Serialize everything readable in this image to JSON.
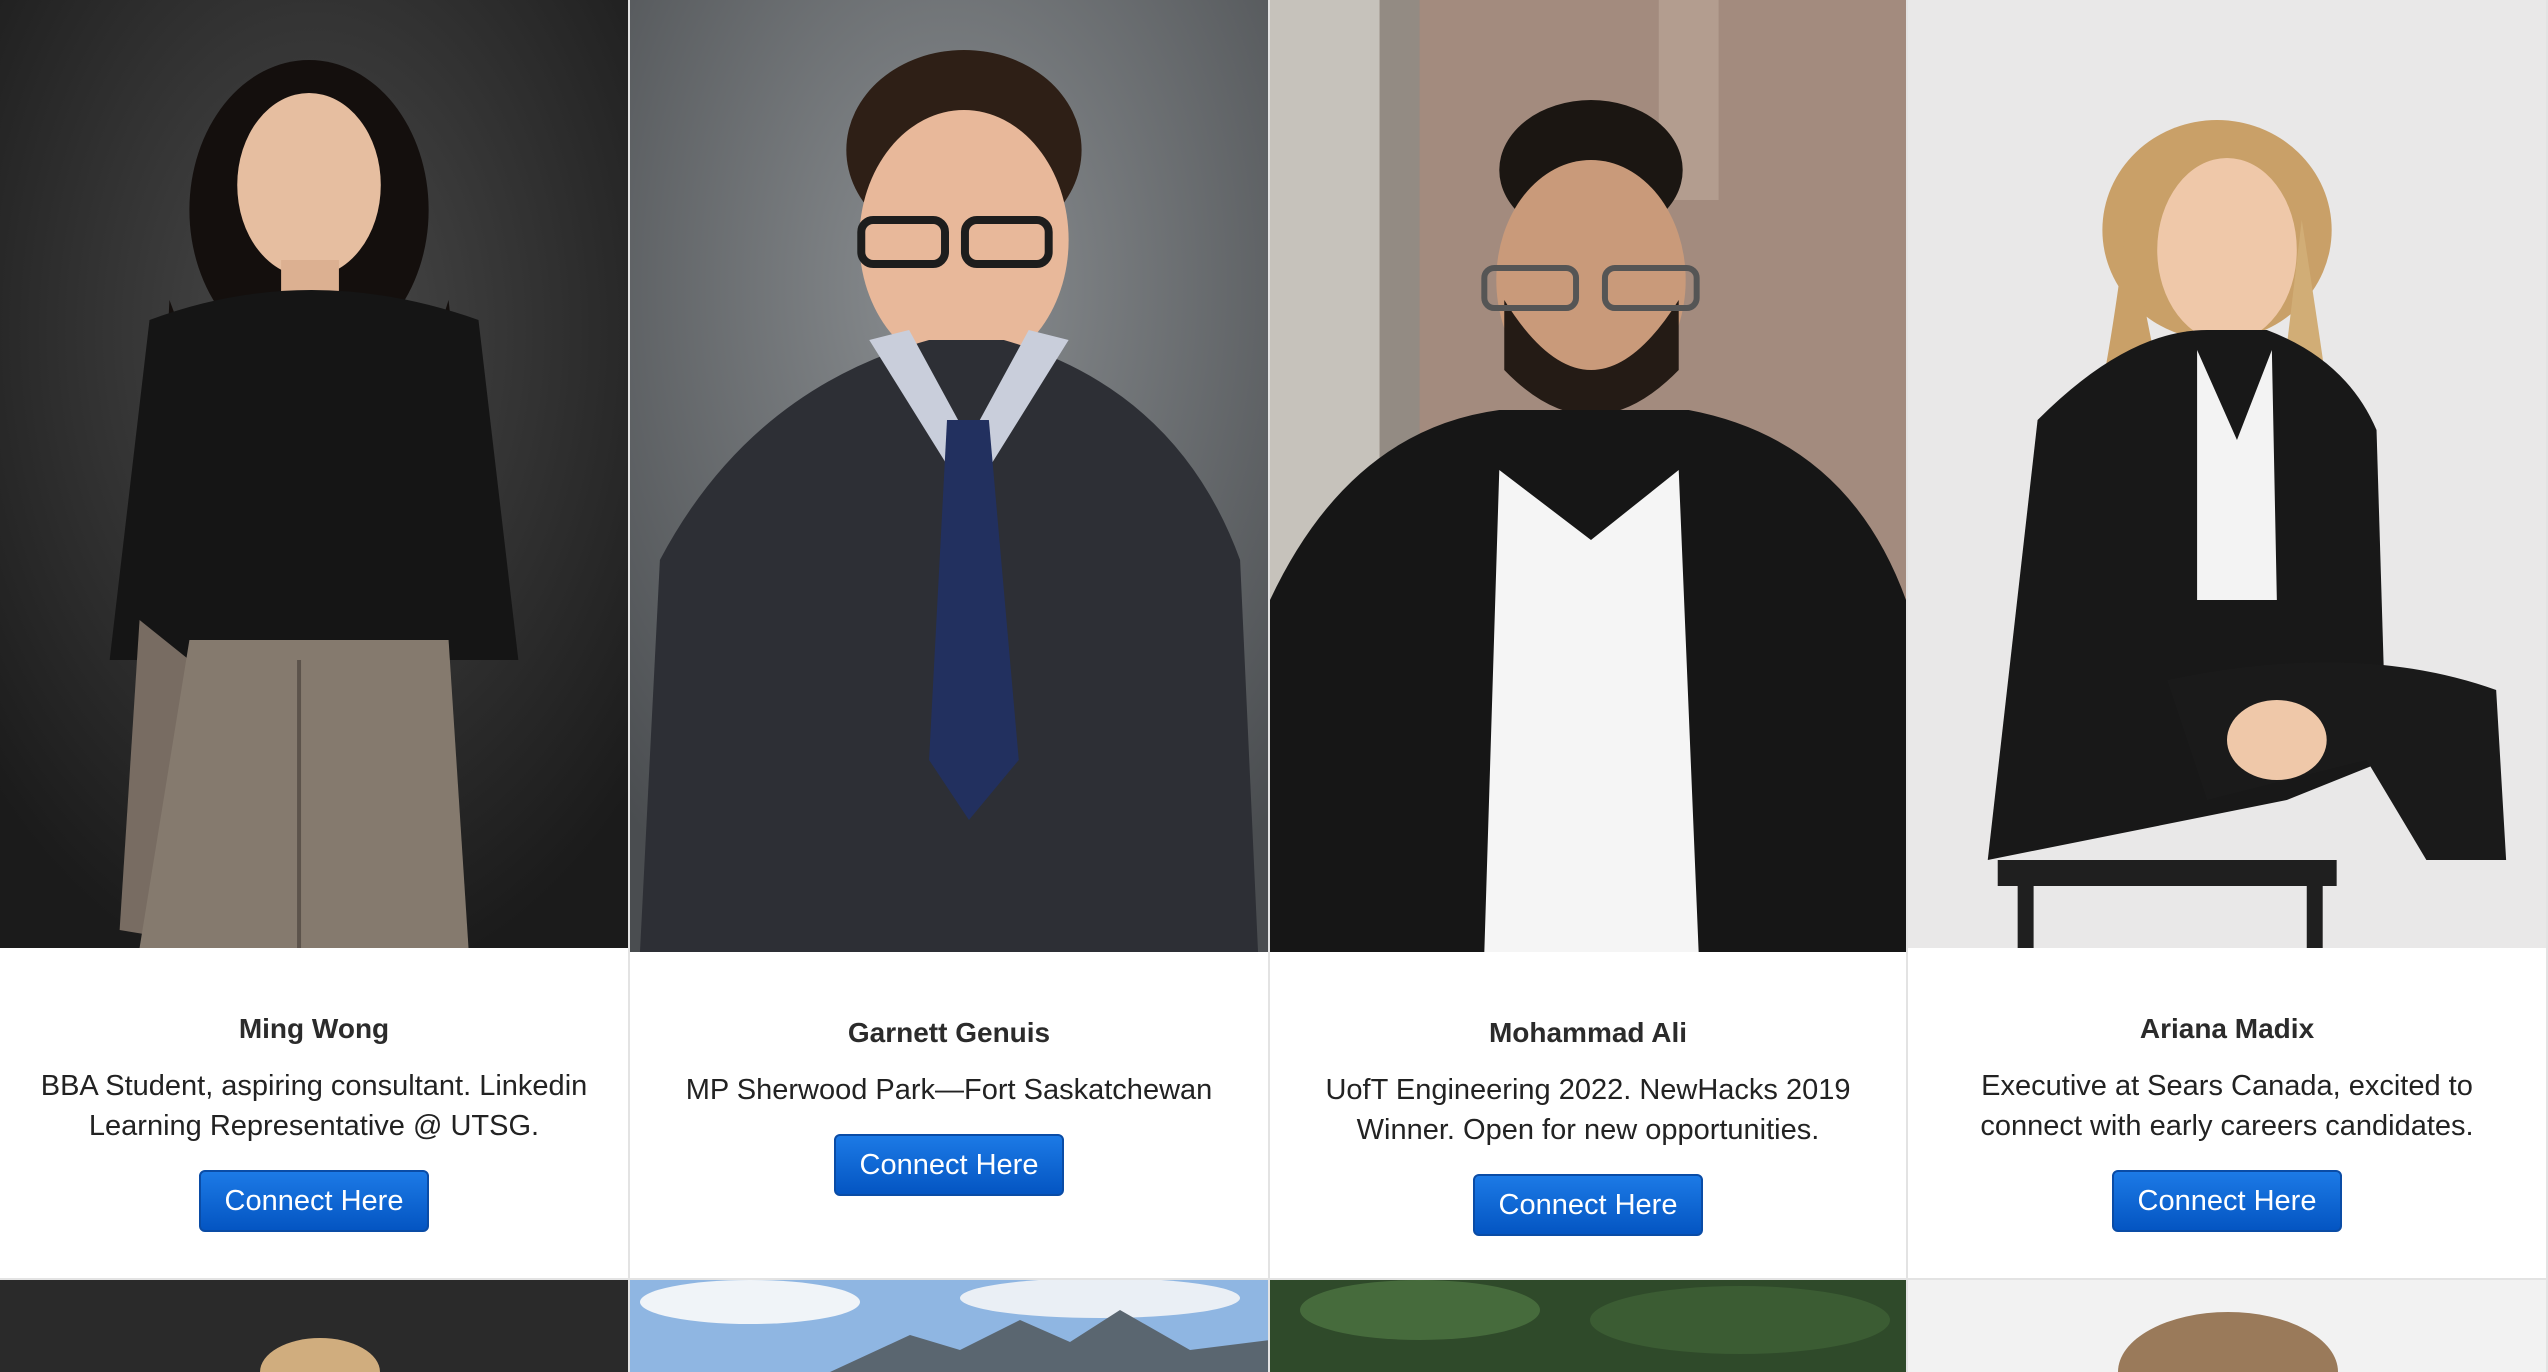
{
  "cards": [
    {
      "name": "Ming Wong",
      "bio": "BBA Student, aspiring consultant. Linkedin Learning Representative @ UTSG.",
      "button": "Connect Here"
    },
    {
      "name": "Garnett Genuis",
      "bio": "MP Sherwood Park—Fort Saskatchewan",
      "button": "Connect Here"
    },
    {
      "name": "Mohammad Ali",
      "bio": "UofT Engineering 2022. NewHacks 2019 Winner. Open for new opportunities.",
      "button": "Connect Here"
    },
    {
      "name": "Ariana Madix",
      "bio": "Executive at Sears Canada, excited to connect with early careers candidates.",
      "button": "Connect Here"
    }
  ],
  "colors": {
    "button": "#0a63d6",
    "name_text": "#2b2b2b"
  }
}
